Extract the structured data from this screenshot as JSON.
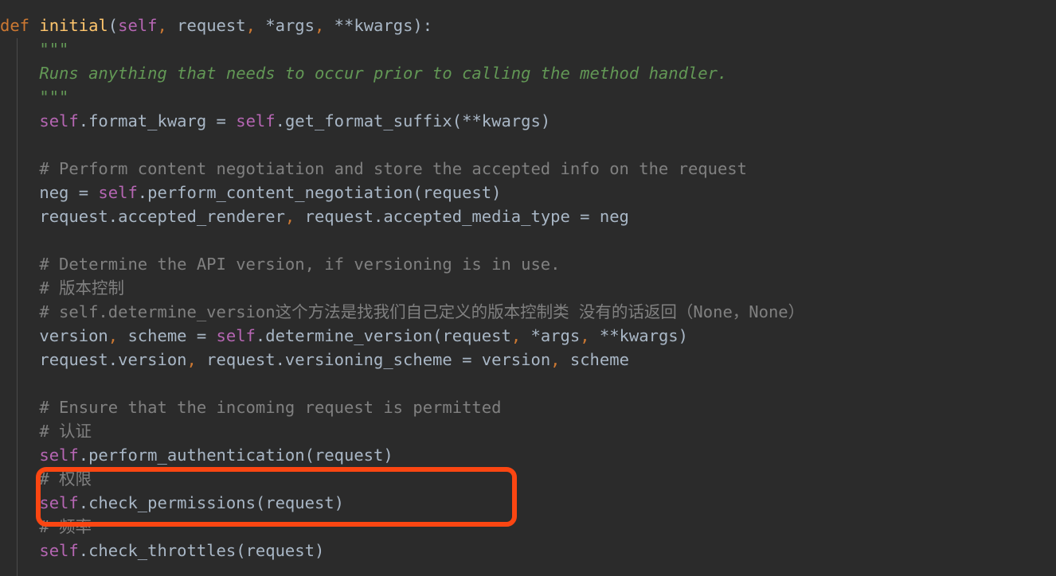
{
  "editor": {
    "theme_name": "darcula-dark",
    "background_color": "#2b2b2b",
    "language": "python",
    "colors": {
      "keyword": "#cc7832",
      "function_name": "#ffc66d",
      "self_keyword": "#b666b3",
      "plain_text": "#a9b7c6",
      "comment": "#808080",
      "docstring": "#629755",
      "indent_guide": "#4a4a4a",
      "annotation_red": "#fb4612"
    }
  },
  "annotation": {
    "shape": "rounded-rectangle",
    "color": "#fb4612",
    "covers_lines": [
      "# 权限",
      "self.check_permissions(request)"
    ]
  },
  "code_lines": [
    {
      "id": "line-1",
      "tokens": [
        {
          "t": "kw",
          "s": "def"
        },
        {
          "t": "txt",
          "s": " "
        },
        {
          "t": "fn",
          "s": "initial"
        },
        {
          "t": "txt",
          "s": "("
        },
        {
          "t": "self",
          "s": "self"
        },
        {
          "t": "punc",
          "s": ","
        },
        {
          "t": "txt",
          "s": " request"
        },
        {
          "t": "punc",
          "s": ","
        },
        {
          "t": "txt",
          "s": " *args"
        },
        {
          "t": "punc",
          "s": ","
        },
        {
          "t": "txt",
          "s": " **kwargs):"
        }
      ]
    },
    {
      "id": "line-2",
      "tokens": [
        {
          "t": "docq",
          "s": "    \"\"\""
        }
      ]
    },
    {
      "id": "line-3",
      "tokens": [
        {
          "t": "doc",
          "s": "    Runs anything that needs to occur prior to calling the method handler."
        }
      ]
    },
    {
      "id": "line-4",
      "tokens": [
        {
          "t": "docq",
          "s": "    \"\"\""
        }
      ]
    },
    {
      "id": "line-5",
      "tokens": [
        {
          "t": "txt",
          "s": "    "
        },
        {
          "t": "self",
          "s": "self"
        },
        {
          "t": "txt",
          "s": ".format_kwarg = "
        },
        {
          "t": "self",
          "s": "self"
        },
        {
          "t": "txt",
          "s": ".get_format_suffix(**kwargs)"
        }
      ]
    },
    {
      "id": "line-6",
      "tokens": []
    },
    {
      "id": "line-7",
      "tokens": [
        {
          "t": "cmt",
          "s": "    # Perform content negotiation and store the accepted info on the request"
        }
      ]
    },
    {
      "id": "line-8",
      "tokens": [
        {
          "t": "txt",
          "s": "    neg = "
        },
        {
          "t": "self",
          "s": "self"
        },
        {
          "t": "txt",
          "s": ".perform_content_negotiation(request)"
        }
      ]
    },
    {
      "id": "line-9",
      "tokens": [
        {
          "t": "txt",
          "s": "    request.accepted_renderer"
        },
        {
          "t": "punc",
          "s": ","
        },
        {
          "t": "txt",
          "s": " request.accepted_media_type = neg"
        }
      ]
    },
    {
      "id": "line-10",
      "tokens": []
    },
    {
      "id": "line-11",
      "tokens": [
        {
          "t": "cmt",
          "s": "    # Determine the API version, if versioning is in use."
        }
      ]
    },
    {
      "id": "line-12",
      "tokens": [
        {
          "t": "cmt",
          "s": "    # 版本控制"
        }
      ]
    },
    {
      "id": "line-13",
      "tokens": [
        {
          "t": "cmt",
          "s": "    # self.determine_version这个方法是找我们自己定义的版本控制类 没有的话返回（None，None）"
        }
      ]
    },
    {
      "id": "line-14",
      "tokens": [
        {
          "t": "txt",
          "s": "    version"
        },
        {
          "t": "punc",
          "s": ","
        },
        {
          "t": "txt",
          "s": " scheme = "
        },
        {
          "t": "self",
          "s": "self"
        },
        {
          "t": "txt",
          "s": ".determine_version(request"
        },
        {
          "t": "punc",
          "s": ","
        },
        {
          "t": "txt",
          "s": " *args"
        },
        {
          "t": "punc",
          "s": ","
        },
        {
          "t": "txt",
          "s": " **kwargs)"
        }
      ]
    },
    {
      "id": "line-15",
      "tokens": [
        {
          "t": "txt",
          "s": "    request.version"
        },
        {
          "t": "punc",
          "s": ","
        },
        {
          "t": "txt",
          "s": " request.versioning_scheme = version"
        },
        {
          "t": "punc",
          "s": ","
        },
        {
          "t": "txt",
          "s": " scheme"
        }
      ]
    },
    {
      "id": "line-16",
      "tokens": []
    },
    {
      "id": "line-17",
      "tokens": [
        {
          "t": "cmt",
          "s": "    # Ensure that the incoming request is permitted"
        }
      ]
    },
    {
      "id": "line-18",
      "tokens": [
        {
          "t": "cmt",
          "s": "    # 认证"
        }
      ]
    },
    {
      "id": "line-19",
      "tokens": [
        {
          "t": "txt",
          "s": "    "
        },
        {
          "t": "self",
          "s": "self"
        },
        {
          "t": "txt",
          "s": ".perform_authentication(request)"
        }
      ]
    },
    {
      "id": "line-20",
      "tokens": [
        {
          "t": "cmt",
          "s": "    # 权限"
        }
      ]
    },
    {
      "id": "line-21",
      "tokens": [
        {
          "t": "txt",
          "s": "    "
        },
        {
          "t": "self",
          "s": "self"
        },
        {
          "t": "txt",
          "s": ".check_permissions(request)"
        }
      ]
    },
    {
      "id": "line-22",
      "tokens": [
        {
          "t": "cmt",
          "s": "    # 频率"
        }
      ]
    },
    {
      "id": "line-23",
      "tokens": [
        {
          "t": "txt",
          "s": "    "
        },
        {
          "t": "self",
          "s": "self"
        },
        {
          "t": "txt",
          "s": ".check_throttles(request)"
        }
      ]
    }
  ]
}
